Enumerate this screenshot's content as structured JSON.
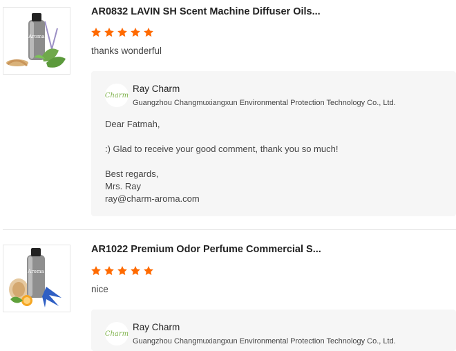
{
  "reviews": [
    {
      "title": "AR0832 LAVIN SH Scent Machine Diffuser Oils...",
      "rating": 5,
      "comment": "thanks wonderful",
      "bottle_label": "Aroma",
      "reply": {
        "logo_text": "Charm",
        "name": "Ray Charm",
        "company": "Guangzhou Changmuxiangxun Environmental Protection Technology Co., Ltd.",
        "lines": [
          "Dear Fatmah,",
          ":) Glad to receive your good comment, thank you so much!",
          "Best regards,",
          "Mrs. Ray",
          "ray@charm-aroma.com"
        ]
      }
    },
    {
      "title": "AR1022 Premium Odor Perfume Commercial S...",
      "rating": 5,
      "comment": "nice",
      "bottle_label": "Aroma",
      "reply": {
        "logo_text": "Charm",
        "name": "Ray Charm",
        "company": "Guangzhou Changmuxiangxun Environmental Protection Technology Co., Ltd."
      }
    }
  ],
  "colors": {
    "star": "#ff6a00",
    "reply_bg": "#f6f6f6",
    "logo_green": "#7fb24c"
  },
  "icons": {
    "star": "star-icon",
    "product": "product-image"
  }
}
